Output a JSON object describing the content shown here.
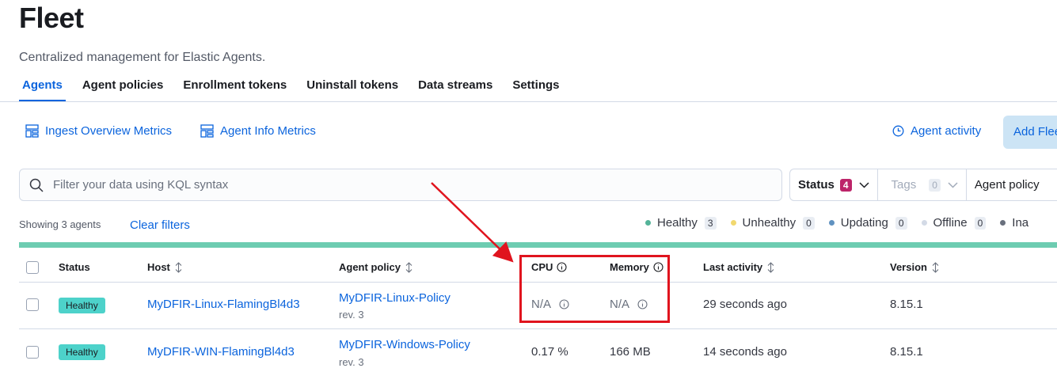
{
  "header": {
    "title": "Fleet",
    "description": "Centralized management for Elastic Agents."
  },
  "tabs": [
    {
      "label": "Agents",
      "active": true
    },
    {
      "label": "Agent policies",
      "active": false
    },
    {
      "label": "Enrollment tokens",
      "active": false
    },
    {
      "label": "Uninstall tokens",
      "active": false
    },
    {
      "label": "Data streams",
      "active": false
    },
    {
      "label": "Settings",
      "active": false
    }
  ],
  "toolbar": {
    "ingest_metrics": "Ingest Overview Metrics",
    "agent_info_metrics": "Agent Info Metrics",
    "agent_activity": "Agent activity",
    "add_fleet": "Add Flee"
  },
  "search": {
    "placeholder": "Filter your data using KQL syntax",
    "value": ""
  },
  "filters": {
    "status_label": "Status",
    "status_count": "4",
    "tags_label": "Tags",
    "tags_count": "0",
    "policy_label": "Agent policy"
  },
  "summary": {
    "showing": "Showing 3 agents",
    "clear_filters": "Clear filters"
  },
  "status_summary": [
    {
      "label": "Healthy",
      "count": "3",
      "color": "#54b399"
    },
    {
      "label": "Unhealthy",
      "count": "0",
      "color": "#f1d86f"
    },
    {
      "label": "Updating",
      "count": "0",
      "color": "#6092c0"
    },
    {
      "label": "Offline",
      "count": "0",
      "color": "#d3dae6"
    },
    {
      "label": "Ina",
      "count": "",
      "color": "#69707d"
    }
  ],
  "table": {
    "headers": {
      "status": "Status",
      "host": "Host",
      "policy": "Agent policy",
      "cpu": "CPU",
      "memory": "Memory",
      "last_activity": "Last activity",
      "version": "Version"
    },
    "rows": [
      {
        "status": "Healthy",
        "host": "MyDFIR-Linux-FlamingBl4d3",
        "policy": "MyDFIR-Linux-Policy",
        "rev": "rev. 3",
        "cpu": "N/A",
        "memory": "N/A",
        "last_activity": "29 seconds ago",
        "version": "8.15.1"
      },
      {
        "status": "Healthy",
        "host": "MyDFIR-WIN-FlamingBl4d3",
        "policy": "MyDFIR-Windows-Policy",
        "rev": "rev. 3",
        "cpu": "0.17 %",
        "memory": "166 MB",
        "last_activity": "14 seconds ago",
        "version": "8.15.1"
      }
    ]
  },
  "colors": {
    "accent": "#0b64dd",
    "health_bar": "#6dccb1",
    "annotation": "#e0141e"
  }
}
